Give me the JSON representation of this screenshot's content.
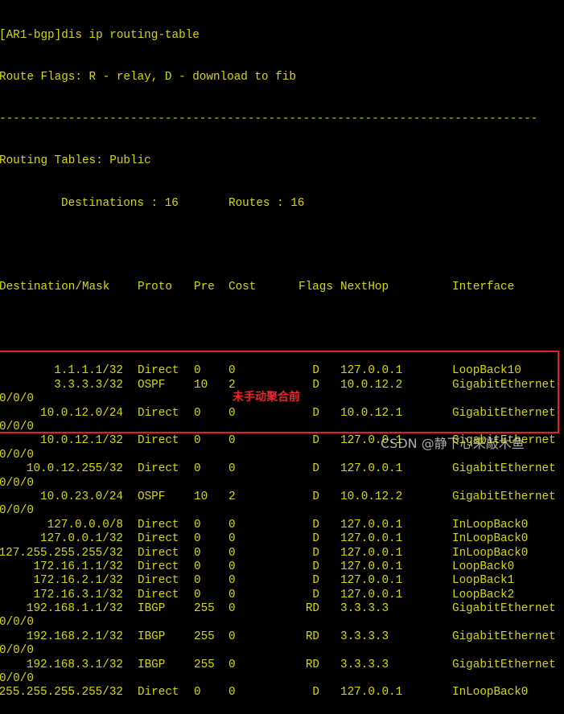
{
  "terminal": {
    "command_prompt": "[AR1-bgp]dis ip routing-table",
    "route_flags": "Route Flags: R - relay, D - download to fib",
    "separator": "------------------------------------------------------------------------------",
    "routing_tables": "Routing Tables: Public",
    "destinations_label": "Destinations : 16",
    "routes_label": "Routes : 16",
    "columns": {
      "destination": "Destination/Mask",
      "proto": "Proto",
      "pre": "Pre",
      "cost": "Cost",
      "flags": "Flags",
      "nexthop": "NextHop",
      "interface": "Interface"
    },
    "rows": [
      {
        "dest": "1.1.1.1/32",
        "proto": "Direct",
        "pre": "0",
        "cost": "0",
        "flags": "D",
        "nexthop": "127.0.0.1",
        "iface": "LoopBack10",
        "wrap": ""
      },
      {
        "dest": "3.3.3.3/32",
        "proto": "OSPF",
        "pre": "10",
        "cost": "2",
        "flags": "D",
        "nexthop": "10.0.12.2",
        "iface": "GigabitEthernet",
        "wrap": "0/0/0"
      },
      {
        "dest": "10.0.12.0/24",
        "proto": "Direct",
        "pre": "0",
        "cost": "0",
        "flags": "D",
        "nexthop": "10.0.12.1",
        "iface": "GigabitEthernet",
        "wrap": "0/0/0"
      },
      {
        "dest": "10.0.12.1/32",
        "proto": "Direct",
        "pre": "0",
        "cost": "0",
        "flags": "D",
        "nexthop": "127.0.0.1",
        "iface": "GigabitEthernet",
        "wrap": "0/0/0"
      },
      {
        "dest": "10.0.12.255/32",
        "proto": "Direct",
        "pre": "0",
        "cost": "0",
        "flags": "D",
        "nexthop": "127.0.0.1",
        "iface": "GigabitEthernet",
        "wrap": "0/0/0"
      },
      {
        "dest": "10.0.23.0/24",
        "proto": "OSPF",
        "pre": "10",
        "cost": "2",
        "flags": "D",
        "nexthop": "10.0.12.2",
        "iface": "GigabitEthernet",
        "wrap": "0/0/0"
      },
      {
        "dest": "127.0.0.0/8",
        "proto": "Direct",
        "pre": "0",
        "cost": "0",
        "flags": "D",
        "nexthop": "127.0.0.1",
        "iface": "InLoopBack0",
        "wrap": ""
      },
      {
        "dest": "127.0.0.1/32",
        "proto": "Direct",
        "pre": "0",
        "cost": "0",
        "flags": "D",
        "nexthop": "127.0.0.1",
        "iface": "InLoopBack0",
        "wrap": ""
      },
      {
        "dest": "127.255.255.255/32",
        "proto": "Direct",
        "pre": "0",
        "cost": "0",
        "flags": "D",
        "nexthop": "127.0.0.1",
        "iface": "InLoopBack0",
        "wrap": ""
      },
      {
        "dest": "172.16.1.1/32",
        "proto": "Direct",
        "pre": "0",
        "cost": "0",
        "flags": "D",
        "nexthop": "127.0.0.1",
        "iface": "LoopBack0",
        "wrap": ""
      },
      {
        "dest": "172.16.2.1/32",
        "proto": "Direct",
        "pre": "0",
        "cost": "0",
        "flags": "D",
        "nexthop": "127.0.0.1",
        "iface": "LoopBack1",
        "wrap": ""
      },
      {
        "dest": "172.16.3.1/32",
        "proto": "Direct",
        "pre": "0",
        "cost": "0",
        "flags": "D",
        "nexthop": "127.0.0.1",
        "iface": "LoopBack2",
        "wrap": ""
      },
      {
        "dest": "192.168.1.1/32",
        "proto": "IBGP",
        "pre": "255",
        "cost": "0",
        "flags": "RD",
        "nexthop": "3.3.3.3",
        "iface": "GigabitEthernet",
        "wrap": "0/0/0"
      },
      {
        "dest": "192.168.2.1/32",
        "proto": "IBGP",
        "pre": "255",
        "cost": "0",
        "flags": "RD",
        "nexthop": "3.3.3.3",
        "iface": "GigabitEthernet",
        "wrap": "0/0/0"
      },
      {
        "dest": "192.168.3.1/32",
        "proto": "IBGP",
        "pre": "255",
        "cost": "0",
        "flags": "RD",
        "nexthop": "3.3.3.3",
        "iface": "GigabitEthernet",
        "wrap": "0/0/0"
      },
      {
        "dest": "255.255.255.255/32",
        "proto": "Direct",
        "pre": "0",
        "cost": "0",
        "flags": "D",
        "nexthop": "127.0.0.1",
        "iface": "InLoopBack0",
        "wrap": ""
      }
    ]
  },
  "annotation": {
    "label": "未手动聚合前",
    "color": "#e0202a"
  },
  "watermark": "CSDN @静下心来敲木鱼",
  "colors": {
    "background": "#000000",
    "text": "#d7d700",
    "highlight": "#e0202a"
  }
}
